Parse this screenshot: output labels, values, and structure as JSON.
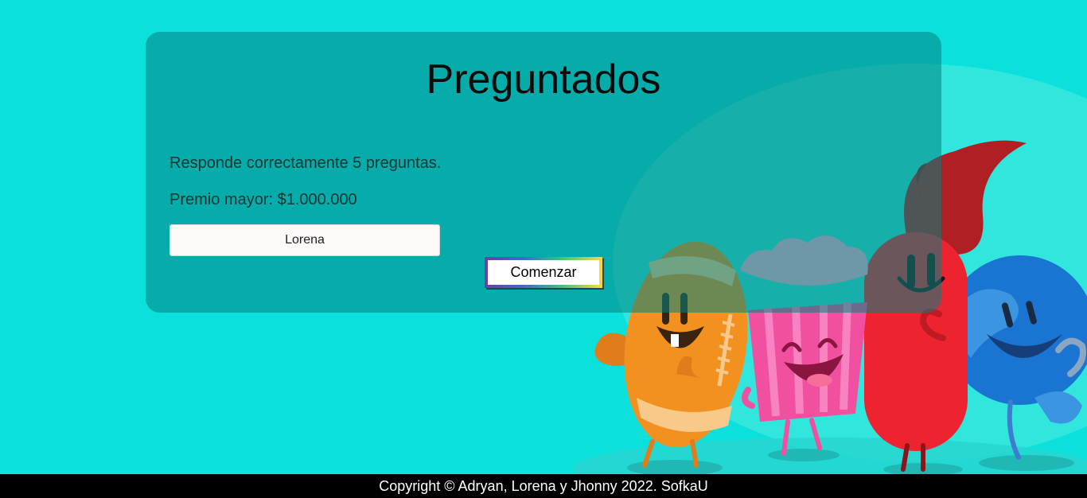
{
  "app": {
    "title": "Preguntados"
  },
  "rules": {
    "line1": "Responde correctamente 5 preguntas.",
    "line2": "Premio mayor: $1.000.000"
  },
  "player": {
    "name_value": "Lorena"
  },
  "actions": {
    "start_label": "Comenzar"
  },
  "footer": {
    "copyright": "Copyright © Adryan, Lorena y Jhonny 2022. SofkaU"
  },
  "colors": {
    "background": "#0ce0dc",
    "card": "#0a9e9c",
    "footer": "#000000"
  },
  "illustration": {
    "characters": [
      "football-character",
      "popcorn-character",
      "paintbrush-character",
      "globe-character"
    ]
  }
}
